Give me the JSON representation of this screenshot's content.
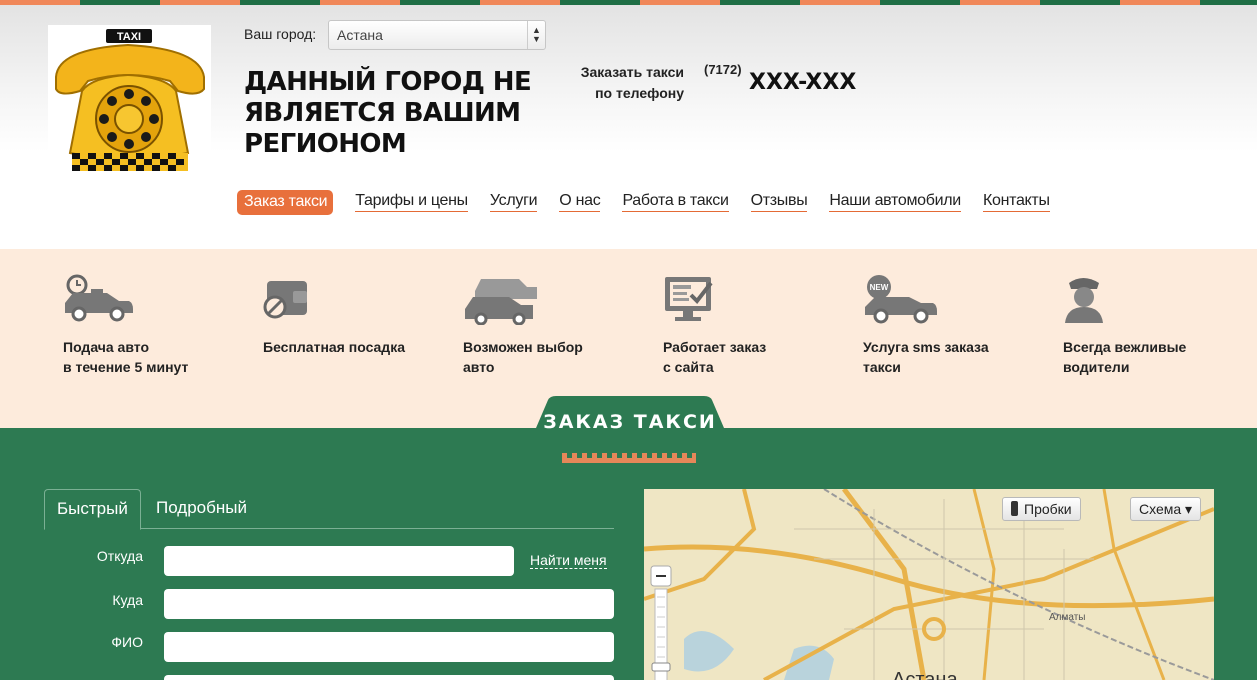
{
  "logo": {
    "sign_text": "TAXI"
  },
  "city": {
    "label": "Ваш город:",
    "selected": "Астана"
  },
  "region_notice": "ДАННЫЙ ГОРОД НЕ ЯВЛЯЕТСЯ ВАШИМ РЕГИОНОМ",
  "phone": {
    "label_line1": "Заказать такси",
    "label_line2": "по телефону",
    "code": "(7172)",
    "number": "XXX-XXX"
  },
  "nav": {
    "items": [
      {
        "label": "Заказ такси",
        "active": true
      },
      {
        "label": "Тарифы и цены"
      },
      {
        "label": "Услуги"
      },
      {
        "label": "О нас"
      },
      {
        "label": "Работа в такси"
      },
      {
        "label": "Отзывы"
      },
      {
        "label": "Наши автомобили"
      },
      {
        "label": "Контакты"
      }
    ]
  },
  "features": [
    {
      "line1": "Подача авто",
      "line2": "в течение 5 минут",
      "icon": "car-clock-icon"
    },
    {
      "line1": "Бесплатная посадка",
      "line2": "",
      "icon": "wallet-no-icon"
    },
    {
      "line1": "Возможен выбор",
      "line2": "авто",
      "icon": "two-cars-icon"
    },
    {
      "line1": "Работает заказ",
      "line2": "с сайта",
      "icon": "monitor-check-icon"
    },
    {
      "line1": "Услуга sms заказа",
      "line2": "такси",
      "icon": "car-new-icon"
    },
    {
      "line1": "Всегда вежливые",
      "line2": "водители",
      "icon": "driver-icon",
      "new_badge": "NEW"
    }
  ],
  "new_badge": "NEW",
  "order_section": {
    "title": "ЗАКАЗ ТАКСИ",
    "tabs": [
      "Быстрый",
      "Подробный"
    ],
    "fields": {
      "from": "Откуда",
      "to": "Куда",
      "name": "ФИО"
    },
    "find_me": "Найти меня"
  },
  "map": {
    "traffic_button": "Пробки",
    "scheme_button": "Схема ▾",
    "city_label": "Астана",
    "road_label": "Алматы"
  },
  "colors": {
    "accent_orange": "#e8703c",
    "brand_green": "#2d7a52",
    "features_bg": "#fdebdc"
  }
}
